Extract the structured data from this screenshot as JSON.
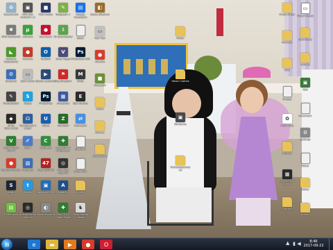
{
  "desktop": {
    "icons": [
      {
        "label": "Recycle Bin",
        "icon": "recycle-bin-icon",
        "color": "#8fb3c9",
        "glyph": "♻"
      },
      {
        "label": "KAR Passwords",
        "icon": "key-icon",
        "color": "#7a7a7a",
        "glyph": "✱"
      },
      {
        "label": "GeForce Experience",
        "icon": "nvidia-icon",
        "color": "#4c9a2a",
        "glyph": "◣"
      },
      {
        "label": "Quickset",
        "icon": "gear-icon",
        "color": "#3d6fb4",
        "glyph": "⚙"
      },
      {
        "label": "PhotoSketch",
        "icon": "app-icon",
        "color": "#444444",
        "glyph": "✎"
      },
      {
        "label": "Unity 2017.3.0f3",
        "icon": "unity-icon",
        "color": "#2a2a2a",
        "glyph": "◆"
      },
      {
        "label": "Grand Theft Auto V",
        "icon": "game-icon",
        "color": "#2e7d32",
        "glyph": "V"
      },
      {
        "label": "Google Chrome",
        "icon": "chrome-icon",
        "color": "#d93b2b",
        "glyph": "●"
      },
      {
        "label": "steam",
        "icon": "steam-icon",
        "color": "#1b2838",
        "glyph": "S"
      },
      {
        "label": "BlueStacks",
        "icon": "bluestacks-icon",
        "color": "#6fbf45",
        "glyph": "▤"
      },
      {
        "label": "MPA Sim Android 1.5",
        "icon": "app-icon",
        "color": "#555555",
        "glyph": "▣"
      },
      {
        "label": "uTorrent",
        "icon": "utorrent-icon",
        "color": "#3aa23a",
        "glyph": "µ"
      },
      {
        "label": "Activate",
        "icon": "app-icon",
        "color": "#c23b2b",
        "glyph": "●"
      },
      {
        "label": "Boot Camp",
        "icon": "app-icon",
        "color": "#bbbbbb",
        "glyph": "▭"
      },
      {
        "label": "Skype",
        "icon": "skype-icon",
        "color": "#1da1e2",
        "glyph": "S"
      },
      {
        "label": "TeamSpeak 3 Client",
        "icon": "teamspeak-icon",
        "color": "#2d5f9e",
        "glyph": "☊"
      },
      {
        "label": "Paint",
        "icon": "paint-icon",
        "color": "#4a7bc8",
        "glyph": "✐"
      },
      {
        "label": "Paint.net",
        "icon": "paint-icon",
        "color": "#3b6fb6",
        "glyph": "▧"
      },
      {
        "label": "Twitter",
        "icon": "twitter-icon",
        "color": "#1d9bf0",
        "glyph": "t"
      },
      {
        "label": "Ubisoft Game Launcher",
        "icon": "ubisoft-icon",
        "color": "#2a2a2a",
        "glyph": "◎"
      },
      {
        "label": "MCH Guide",
        "icon": "app-icon",
        "color": "#2a3a6a",
        "glyph": "■"
      },
      {
        "label": "Bandicam",
        "icon": "bandicam-icon",
        "color": "#c8102e",
        "glyph": "●"
      },
      {
        "label": "Outlook",
        "icon": "outlook-icon",
        "color": "#0f5ea8",
        "glyph": "O"
      },
      {
        "label": "Steam Launcher",
        "icon": "app-icon",
        "color": "#2a4a7a",
        "glyph": "▶"
      },
      {
        "label": "Photoshop",
        "icon": "photoshop-icon",
        "color": "#001d34",
        "glyph": "Ps"
      },
      {
        "label": "Uplay",
        "icon": "uplay-icon",
        "color": "#1b5fb0",
        "glyph": "U"
      },
      {
        "label": "Camtasia",
        "icon": "app-icon",
        "color": "#2f8f3f",
        "glyph": "C"
      },
      {
        "label": "Play ABTMAN",
        "icon": "game-icon",
        "color": "#b22222",
        "glyph": "47"
      },
      {
        "label": "Camtasia 2 MCH",
        "icon": "app-icon",
        "color": "#1f6fbf",
        "glyph": "▣"
      },
      {
        "label": "Ukidz Shortcut",
        "icon": "app-icon",
        "color": "#888888",
        "glyph": "◐"
      },
      {
        "label": "Notepad++",
        "icon": "notepad-icon",
        "color": "#7fb04a",
        "glyph": "✎"
      },
      {
        "label": "4K Downloader",
        "icon": "download-icon",
        "color": "#5aa64a",
        "glyph": "⇩"
      },
      {
        "label": "Sony Vegas",
        "icon": "app-icon",
        "color": "#4c4c7a",
        "glyph": "V"
      },
      {
        "label": "Flag Kingdom",
        "icon": "flag-icon",
        "color": "#cc2b2b",
        "glyph": "⚑"
      },
      {
        "label": "Ancestors",
        "icon": "app-icon",
        "color": "#3c5aa0",
        "glyph": "▦"
      },
      {
        "label": "Zomboid",
        "icon": "game-icon",
        "color": "#2a6a2a",
        "glyph": "Z"
      },
      {
        "label": "Play GTA VI Multiplayer",
        "icon": "game-icon",
        "color": "#2e7d32",
        "glyph": "✚"
      },
      {
        "label": "Play Apex Legends",
        "icon": "game-icon",
        "color": "#333333",
        "glyph": "◎"
      },
      {
        "label": "Audacity",
        "icon": "audacity-icon",
        "color": "#1d4f91",
        "glyph": "A"
      },
      {
        "label": "Play GTA V Single Player",
        "icon": "game-icon",
        "color": "#2e7d32",
        "glyph": "✚"
      },
      {
        "label": "Google Classroom",
        "icon": "app-icon",
        "color": "#1a73e8",
        "glyph": "▤"
      },
      {
        "label": "Blank",
        "icon": "file-icon",
        "color": "#eeeeee",
        "glyph": ""
      },
      {
        "label": "Photoshop CS6",
        "icon": "photoshop-icon",
        "color": "#001d34",
        "glyph": "Ps"
      },
      {
        "label": "Mafia",
        "icon": "game-icon",
        "color": "#3a3a3a",
        "glyph": "M"
      },
      {
        "label": "Epic Games",
        "icon": "app-icon",
        "color": "#2b2b2b",
        "glyph": "E"
      },
      {
        "label": "Connector",
        "icon": "app-icon",
        "color": "#4a90e2",
        "glyph": "⇄"
      },
      {
        "label": "Shortcut",
        "icon": "file-icon",
        "color": "#f0f0f0",
        "glyph": ""
      },
      {
        "label": "Document",
        "icon": "file-icon",
        "color": "#f0f0f0",
        "glyph": ""
      },
      {
        "label": "Drivers",
        "icon": "folder-icon",
        "color": "#e8c35a",
        "glyph": ""
      },
      {
        "label": "Chess Backup Creator",
        "icon": "chess-icon",
        "color": "#d8d8d8",
        "glyph": "♞"
      },
      {
        "label": "Game Shortcut",
        "icon": "app-icon",
        "color": "#9a6b2f",
        "glyph": "◧"
      },
      {
        "label": "Mod Tool",
        "icon": "app-icon",
        "color": "#c0c0c0",
        "glyph": "▭"
      },
      {
        "label": "Chrome",
        "icon": "chrome-icon",
        "color": "#d93b2b",
        "glyph": "●"
      },
      {
        "label": "Minecraft",
        "icon": "minecraft-icon",
        "color": "#6b8f3a",
        "glyph": "■"
      },
      {
        "label": "Folder",
        "icon": "folder-icon",
        "color": "#e8c35a",
        "glyph": ""
      },
      {
        "label": "Drivers",
        "icon": "folder-icon",
        "color": "#e8c35a",
        "glyph": ""
      },
      {
        "label": "Documents",
        "icon": "folder-icon",
        "color": "#e8c35a",
        "glyph": ""
      },
      {
        "label": "Folder",
        "icon": "folder-icon",
        "color": "#e8c35a",
        "glyph": ""
      },
      {
        "label": "Steam Games",
        "icon": "folder-icon",
        "color": "#e8c35a",
        "glyph": ""
      },
      {
        "label": "WinGame",
        "icon": "app-icon",
        "color": "#4a4a4a",
        "glyph": "▣"
      },
      {
        "label": "PortableDownload",
        "icon": "folder-icon",
        "color": "#e8c35a",
        "glyph": ""
      },
      {
        "label": "Photo Finder",
        "icon": "folder-icon",
        "color": "#e8c35a",
        "glyph": ""
      },
      {
        "label": "Backups",
        "icon": "folder-icon",
        "color": "#e8c35a",
        "glyph": ""
      },
      {
        "label": "Misc",
        "icon": "folder-icon",
        "color": "#e8c35a",
        "glyph": ""
      },
      {
        "label": "Images",
        "icon": "file-icon",
        "color": "#f0f0f0",
        "glyph": ""
      },
      {
        "label": "Hello Kitty",
        "icon": "app-icon",
        "color": "#ffffff",
        "glyph": "✿"
      },
      {
        "label": "Projects",
        "icon": "folder-icon",
        "color": "#e8c35a",
        "glyph": ""
      },
      {
        "label": "BLOCKS DVD Unlock",
        "icon": "app-icon",
        "color": "#2a2a2a",
        "glyph": "▦"
      },
      {
        "label": "Shortcut",
        "icon": "folder-icon",
        "color": "#e8c35a",
        "glyph": ""
      },
      {
        "label": "Video Project",
        "icon": "file-icon",
        "color": "#ffffff",
        "glyph": "▭"
      },
      {
        "label": "Downloads",
        "icon": "folder-icon",
        "color": "#e8c35a",
        "glyph": ""
      },
      {
        "label": "Schools",
        "icon": "folder-icon",
        "color": "#e8c35a",
        "glyph": ""
      },
      {
        "label": "App",
        "icon": "app-icon",
        "color": "#3a7a3a",
        "glyph": "▣"
      },
      {
        "label": "Document",
        "icon": "file-icon",
        "color": "#f0f0f0",
        "glyph": ""
      },
      {
        "label": "Settings",
        "icon": "gear-icon",
        "color": "#888888",
        "glyph": "⚙"
      },
      {
        "label": "Notes",
        "icon": "file-icon",
        "color": "#f0f0f0",
        "glyph": ""
      },
      {
        "label": "Folder",
        "icon": "folder-icon",
        "color": "#e8c35a",
        "glyph": ""
      },
      {
        "label": "pucket",
        "icon": "folder-icon",
        "color": "#e8c35a",
        "glyph": ""
      }
    ]
  },
  "taskbar": {
    "start_icon": "windows-start-icon",
    "pinned": [
      {
        "name": "internet-explorer-icon",
        "color": "#1f77d0",
        "glyph": "e"
      },
      {
        "name": "file-explorer-icon",
        "color": "#e0b53b",
        "glyph": "▬"
      },
      {
        "name": "media-player-icon",
        "color": "#e07a1f",
        "glyph": "▶"
      },
      {
        "name": "chrome-icon",
        "color": "#d93b2b",
        "glyph": "●"
      },
      {
        "name": "opera-icon",
        "color": "#cc1f2f",
        "glyph": "O"
      }
    ],
    "clock_time": "8:46",
    "clock_date": "2017-09-22"
  }
}
